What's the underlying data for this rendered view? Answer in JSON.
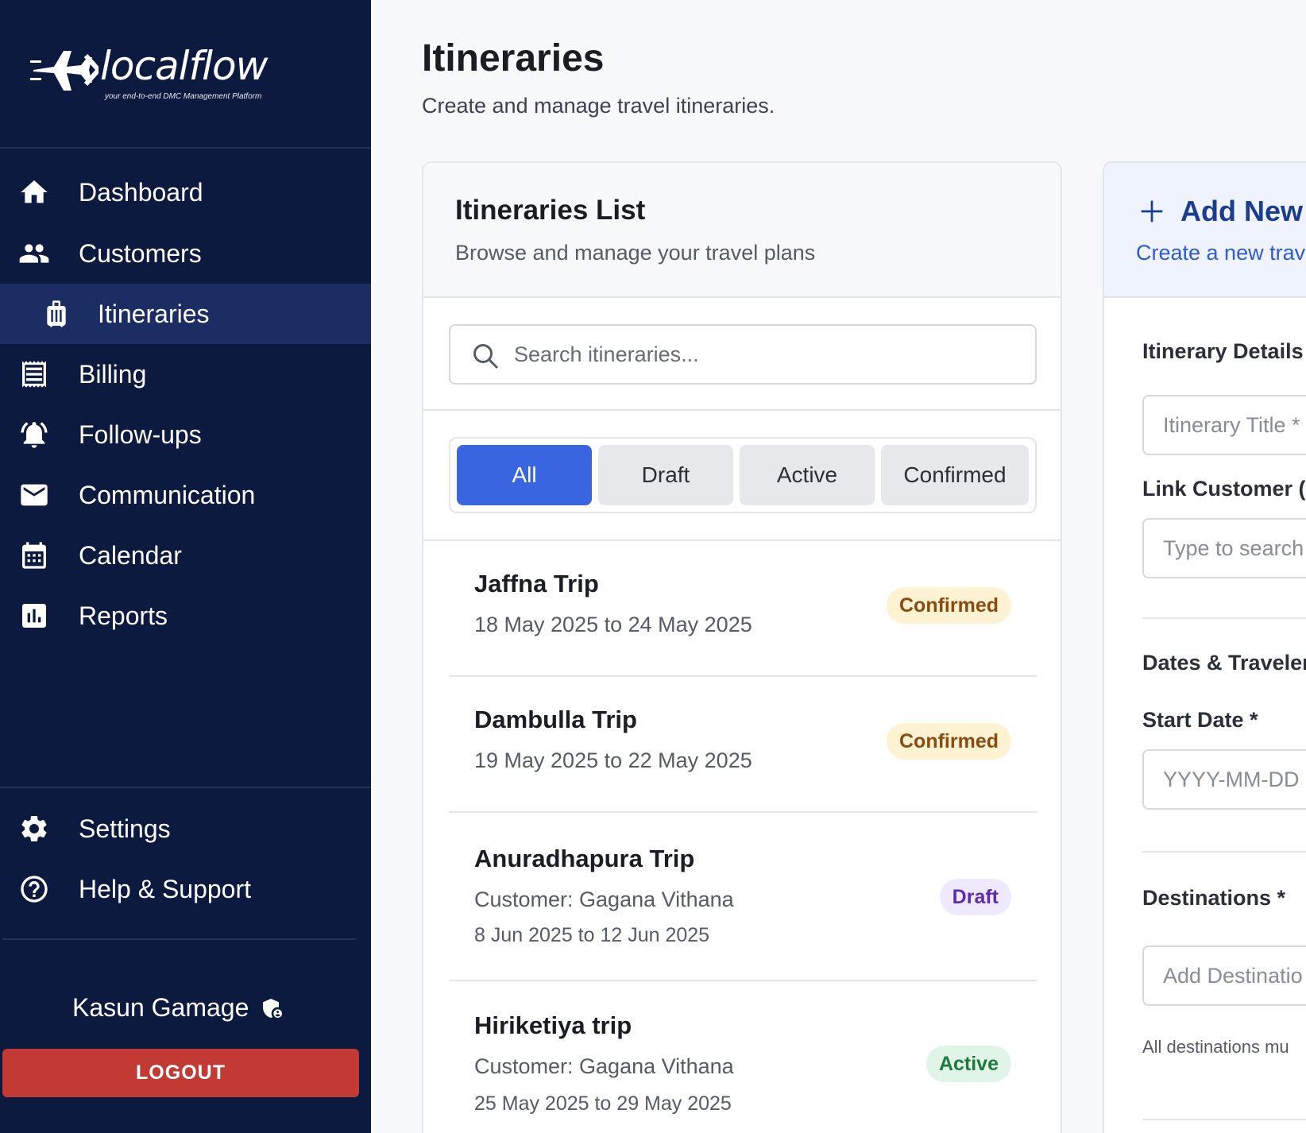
{
  "brand": {
    "name": "localflow",
    "tagline": "your end-to-end DMC Management Platform"
  },
  "sidebar": {
    "items": [
      {
        "label": "Dashboard",
        "icon": "home-icon"
      },
      {
        "label": "Customers",
        "icon": "people-icon"
      },
      {
        "label": "Itineraries",
        "icon": "luggage-icon",
        "active": true
      },
      {
        "label": "Billing",
        "icon": "receipt-icon"
      },
      {
        "label": "Follow-ups",
        "icon": "bell-icon"
      },
      {
        "label": "Communication",
        "icon": "mail-icon"
      },
      {
        "label": "Calendar",
        "icon": "calendar-icon"
      },
      {
        "label": "Reports",
        "icon": "bar-chart-icon"
      }
    ],
    "bottom_items": [
      {
        "label": "Settings",
        "icon": "gear-icon"
      },
      {
        "label": "Help & Support",
        "icon": "help-icon"
      }
    ],
    "user": {
      "name": "Kasun Gamage",
      "icon": "admin-shield-icon"
    },
    "logout_label": "LOGOUT"
  },
  "page": {
    "title": "Itineraries",
    "subtitle": "Create and manage travel itineraries."
  },
  "list": {
    "title": "Itineraries List",
    "subtitle": "Browse and manage your travel plans",
    "search_placeholder": "Search itineraries...",
    "filters": [
      "All",
      "Draft",
      "Active",
      "Confirmed"
    ],
    "selected_filter": "All",
    "items": [
      {
        "title": "Jaffna Trip",
        "customer": "",
        "dates": "18 May 2025 to 24 May 2025",
        "status": "Confirmed"
      },
      {
        "title": "Dambulla Trip",
        "customer": "",
        "dates": "19 May 2025 to 22 May 2025",
        "status": "Confirmed"
      },
      {
        "title": "Anuradhapura Trip",
        "customer": "Customer: Gagana Vithana",
        "dates": "8 Jun 2025 to 12 Jun 2025",
        "status": "Draft"
      },
      {
        "title": "Hiriketiya trip",
        "customer": "Customer: Gagana Vithana",
        "dates": "25 May 2025 to 29 May 2025",
        "status": "Active"
      }
    ]
  },
  "add_form": {
    "title": "Add New",
    "subtitle": "Create a new trav",
    "sections": {
      "details": "Itinerary Details",
      "link_customer": "Link Customer (",
      "dates_travelers": "Dates & Traveler",
      "start_date": "Start Date *",
      "destinations": "Destinations *"
    },
    "placeholders": {
      "title": "Itinerary Title *",
      "customer": "Type to search",
      "start_date": "YYYY-MM-DD",
      "destination": "Add Destinatio"
    },
    "note": "All destinations mu"
  },
  "colors": {
    "sidebar_bg": "#0d1a3f",
    "sidebar_active": "#1b2d63",
    "primary": "#3a65e0",
    "logout": "#c23a33",
    "confirmed_bg": "#fdf3d2",
    "confirmed_text": "#8a4b10",
    "draft_bg": "#efe9fd",
    "draft_text": "#5b2bb5",
    "active_bg": "#e0f5e8",
    "active_text": "#1e7a3c"
  }
}
